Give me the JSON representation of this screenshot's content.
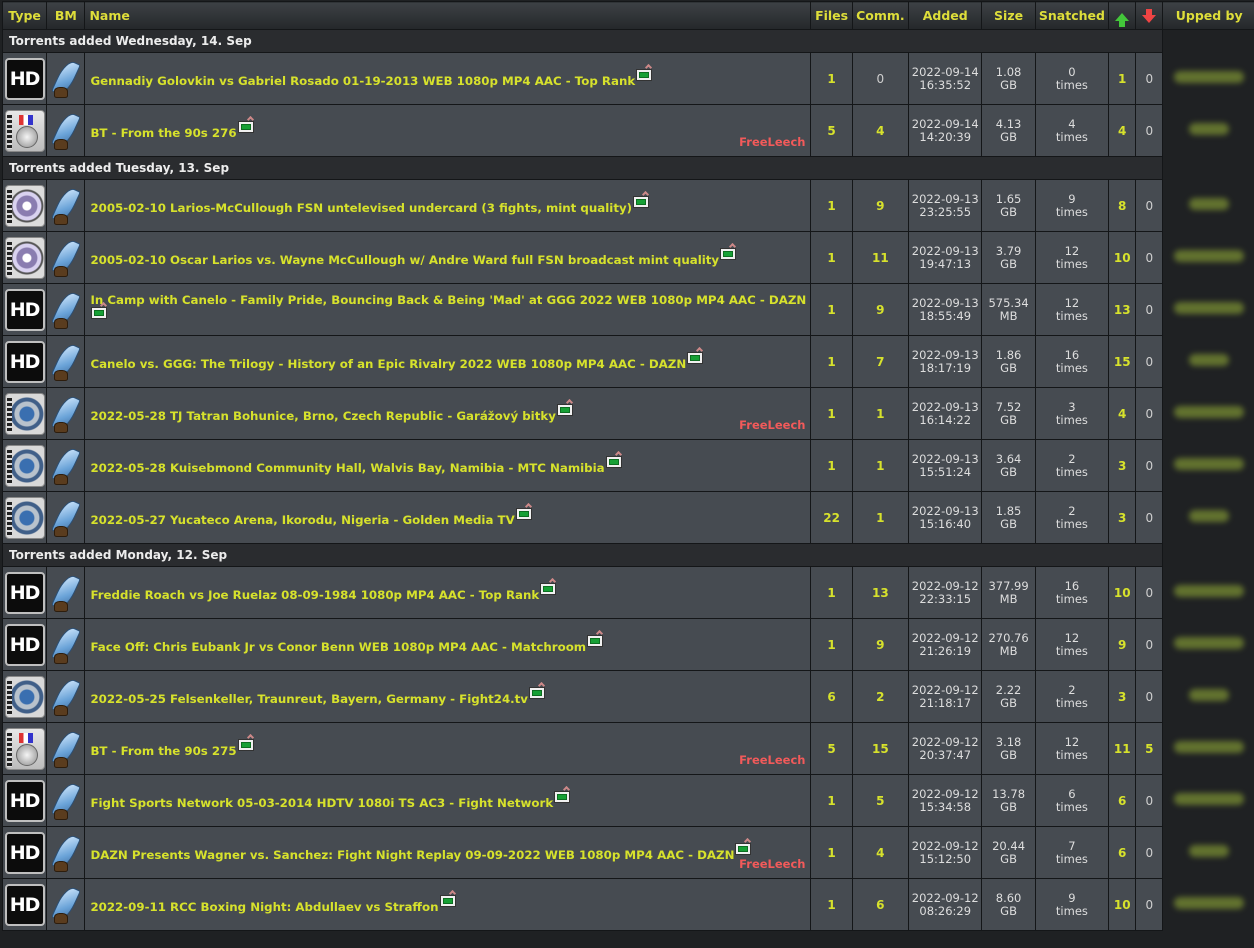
{
  "header": {
    "type": "Type",
    "bm": "BM",
    "name": "Name",
    "files": "Files",
    "comments": "Comm.",
    "added": "Added",
    "size": "Size",
    "snatched": "Snatched",
    "seeders_icon": "arrow-up-icon",
    "leechers_icon": "arrow-down-icon",
    "upped_by": "Upped by"
  },
  "groups": [
    {
      "date_label": "Torrents added Wednesday, 14. Sep",
      "rows": [
        {
          "type": "hd",
          "name": "Gennadiy Golovkin vs Gabriel Rosado 01-19-2013 WEB 1080p MP4 AAC - Top Rank",
          "freeleech": "",
          "files": "1",
          "comments": "0",
          "date": "2022-09-14",
          "time": "16:35:52",
          "size_num": "1.08",
          "size_unit": "GB",
          "snatched": "0",
          "times": "times",
          "seeders": "1",
          "leechers": "0"
        },
        {
          "type": "medal",
          "name": "BT - From the 90s 276",
          "freeleech": "FreeLeech",
          "files": "5",
          "comments": "4",
          "date": "2022-09-14",
          "time": "14:20:39",
          "size_num": "4.13",
          "size_unit": "GB",
          "snatched": "4",
          "times": "times",
          "seeders": "4",
          "leechers": "0"
        }
      ]
    },
    {
      "date_label": "Torrents added Tuesday, 13. Sep",
      "rows": [
        {
          "type": "disc",
          "name": "2005-02-10 Larios-McCullough FSN untelevised undercard (3 fights, mint quality)",
          "freeleech": "",
          "files": "1",
          "comments": "9",
          "date": "2022-09-13",
          "time": "23:25:55",
          "size_num": "1.65",
          "size_unit": "GB",
          "snatched": "9",
          "times": "times",
          "seeders": "8",
          "leechers": "0"
        },
        {
          "type": "disc",
          "name": "2005-02-10 Oscar Larios vs. Wayne McCullough w/ Andre Ward full FSN broadcast mint quality",
          "freeleech": "",
          "files": "1",
          "comments": "11",
          "date": "2022-09-13",
          "time": "19:47:13",
          "size_num": "3.79",
          "size_unit": "GB",
          "snatched": "12",
          "times": "times",
          "seeders": "10",
          "leechers": "0"
        },
        {
          "type": "hd",
          "name": "In Camp with Canelo - Family Pride, Bouncing Back & Being 'Mad' at GGG 2022 WEB 1080p MP4 AAC - DAZN",
          "freeleech": "",
          "files": "1",
          "comments": "9",
          "date": "2022-09-13",
          "time": "18:55:49",
          "size_num": "575.34",
          "size_unit": "MB",
          "snatched": "12",
          "times": "times",
          "seeders": "13",
          "leechers": "0"
        },
        {
          "type": "hd",
          "name": "Canelo vs. GGG: The Trilogy - History of an Epic Rivalry 2022 WEB 1080p MP4 AAC - DAZN",
          "freeleech": "",
          "files": "1",
          "comments": "7",
          "date": "2022-09-13",
          "time": "18:17:19",
          "size_num": "1.86",
          "size_unit": "GB",
          "snatched": "16",
          "times": "times",
          "seeders": "15",
          "leechers": "0"
        },
        {
          "type": "earth",
          "name": "2022-05-28 TJ Tatran Bohunice, Brno, Czech Republic - Garážový bitky",
          "freeleech": "FreeLeech",
          "files": "1",
          "comments": "1",
          "date": "2022-09-13",
          "time": "16:14:22",
          "size_num": "7.52",
          "size_unit": "GB",
          "snatched": "3",
          "times": "times",
          "seeders": "4",
          "leechers": "0"
        },
        {
          "type": "earth",
          "name": "2022-05-28 Kuisebmond Community Hall, Walvis Bay, Namibia - MTC Namibia",
          "freeleech": "",
          "files": "1",
          "comments": "1",
          "date": "2022-09-13",
          "time": "15:51:24",
          "size_num": "3.64",
          "size_unit": "GB",
          "snatched": "2",
          "times": "times",
          "seeders": "3",
          "leechers": "0"
        },
        {
          "type": "earth",
          "name": "2022-05-27 Yucateco Arena, Ikorodu, Nigeria - Golden Media TV",
          "freeleech": "",
          "files": "22",
          "comments": "1",
          "date": "2022-09-13",
          "time": "15:16:40",
          "size_num": "1.85",
          "size_unit": "GB",
          "snatched": "2",
          "times": "times",
          "seeders": "3",
          "leechers": "0"
        }
      ]
    },
    {
      "date_label": "Torrents added Monday, 12. Sep",
      "rows": [
        {
          "type": "hd",
          "name": "Freddie Roach vs Joe Ruelaz 08-09-1984 1080p MP4 AAC - Top Rank",
          "freeleech": "",
          "files": "1",
          "comments": "13",
          "date": "2022-09-12",
          "time": "22:33:15",
          "size_num": "377.99",
          "size_unit": "MB",
          "snatched": "16",
          "times": "times",
          "seeders": "10",
          "leechers": "0"
        },
        {
          "type": "hd",
          "name": "Face Off: Chris Eubank Jr vs Conor Benn WEB 1080p MP4 AAC - Matchroom",
          "freeleech": "",
          "files": "1",
          "comments": "9",
          "date": "2022-09-12",
          "time": "21:26:19",
          "size_num": "270.76",
          "size_unit": "MB",
          "snatched": "12",
          "times": "times",
          "seeders": "9",
          "leechers": "0"
        },
        {
          "type": "earth",
          "name": "2022-05-25 Felsenkeller, Traunreut, Bayern, Germany - Fight24.tv",
          "freeleech": "",
          "files": "6",
          "comments": "2",
          "date": "2022-09-12",
          "time": "21:18:17",
          "size_num": "2.22",
          "size_unit": "GB",
          "snatched": "2",
          "times": "times",
          "seeders": "3",
          "leechers": "0"
        },
        {
          "type": "medal",
          "name": "BT - From the 90s 275",
          "freeleech": "FreeLeech",
          "files": "5",
          "comments": "15",
          "date": "2022-09-12",
          "time": "20:37:47",
          "size_num": "3.18",
          "size_unit": "GB",
          "snatched": "12",
          "times": "times",
          "seeders": "11",
          "leechers": "5"
        },
        {
          "type": "hd",
          "name": "Fight Sports Network 05-03-2014 HDTV 1080i TS AC3 - Fight Network",
          "freeleech": "",
          "files": "1",
          "comments": "5",
          "date": "2022-09-12",
          "time": "15:34:58",
          "size_num": "13.78",
          "size_unit": "GB",
          "snatched": "6",
          "times": "times",
          "seeders": "6",
          "leechers": "0"
        },
        {
          "type": "hd",
          "name": "DAZN Presents Wagner vs. Sanchez: Fight Night Replay 09-09-2022 WEB 1080p MP4 AAC - DAZN",
          "freeleech": "FreeLeech",
          "files": "1",
          "comments": "4",
          "date": "2022-09-12",
          "time": "15:12:50",
          "size_num": "20.44",
          "size_unit": "GB",
          "snatched": "7",
          "times": "times",
          "seeders": "6",
          "leechers": "0"
        },
        {
          "type": "hd",
          "name": "2022-09-11 RCC Boxing Night: Abdullaev vs Straffon",
          "freeleech": "",
          "files": "1",
          "comments": "6",
          "date": "2022-09-12",
          "time": "08:26:29",
          "size_num": "8.60",
          "size_unit": "GB",
          "snatched": "9",
          "times": "times",
          "seeders": "10",
          "leechers": "0"
        }
      ]
    }
  ],
  "type_labels": {
    "hd": "HD"
  },
  "icons": {
    "bookmark": "feather-bookmark-icon",
    "download": "download-icon"
  }
}
